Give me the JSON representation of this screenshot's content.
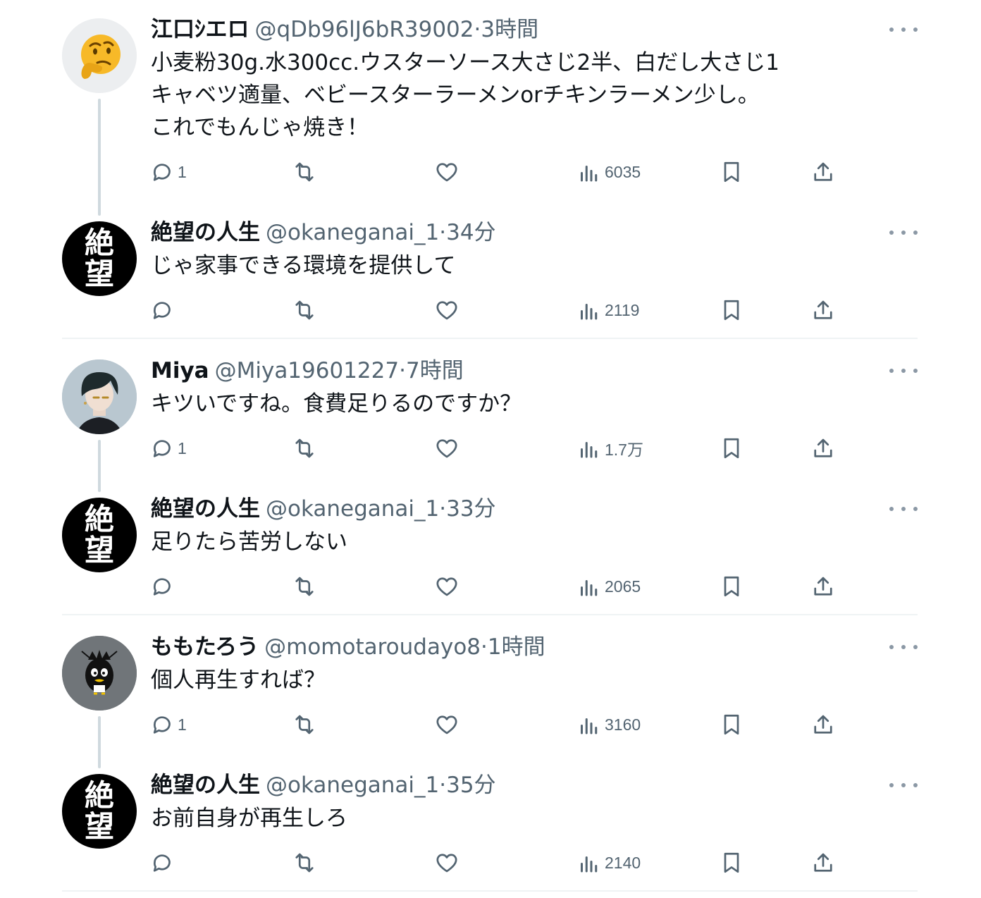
{
  "tweets": [
    {
      "name": "江口ｼエロ",
      "handle": "@qDb96lJ6bR39002",
      "sep": "·",
      "time": "3時間",
      "lines": [
        "小麦粉30g.水300cc.ウスターソース大さじ2半、白だし大さじ1",
        "キャベツ適量、ベビースターラーメンorチキンラーメン少し。",
        "これでもんじゃ焼き！"
      ],
      "reply_count": "1",
      "views": "6035"
    },
    {
      "name": "絶望の人生",
      "handle": "@okaneganai_1",
      "sep": "·",
      "time": "34分",
      "lines": [
        "じゃ家事できる環境を提供して"
      ],
      "reply_count": "",
      "views": "2119"
    },
    {
      "name": "Miya",
      "handle": "@Miya19601227",
      "sep": "·",
      "time": "7時間",
      "lines": [
        "キツいですね。食費足りるのですか？"
      ],
      "reply_count": "1",
      "views": "1.7万"
    },
    {
      "name": "絶望の人生",
      "handle": "@okaneganai_1",
      "sep": "·",
      "time": "33分",
      "lines": [
        "足りたら苦労しない"
      ],
      "reply_count": "",
      "views": "2065"
    },
    {
      "name": "ももたろう",
      "handle": "@momotaroudayo8",
      "sep": "·",
      "time": "1時間",
      "lines": [
        "個人再生すれば？"
      ],
      "reply_count": "1",
      "views": "3160"
    },
    {
      "name": "絶望の人生",
      "handle": "@okaneganai_1",
      "sep": "·",
      "time": "35分",
      "lines": [
        "お前自身が再生しろ"
      ],
      "reply_count": "",
      "views": "2140"
    }
  ],
  "avatars": {
    "zetsubou_text": [
      "絶",
      "望"
    ],
    "thinking_emoji": "🤔"
  },
  "icons": {
    "reply": "reply-icon",
    "retweet": "retweet-icon",
    "like": "heart-icon",
    "views": "views-icon",
    "bookmark": "bookmark-icon",
    "share": "share-icon",
    "more": "more-icon"
  },
  "colors": {
    "text": "#0f1419",
    "secondary": "#536471",
    "divider": "#eff3f4",
    "thread": "#cfd9de"
  }
}
